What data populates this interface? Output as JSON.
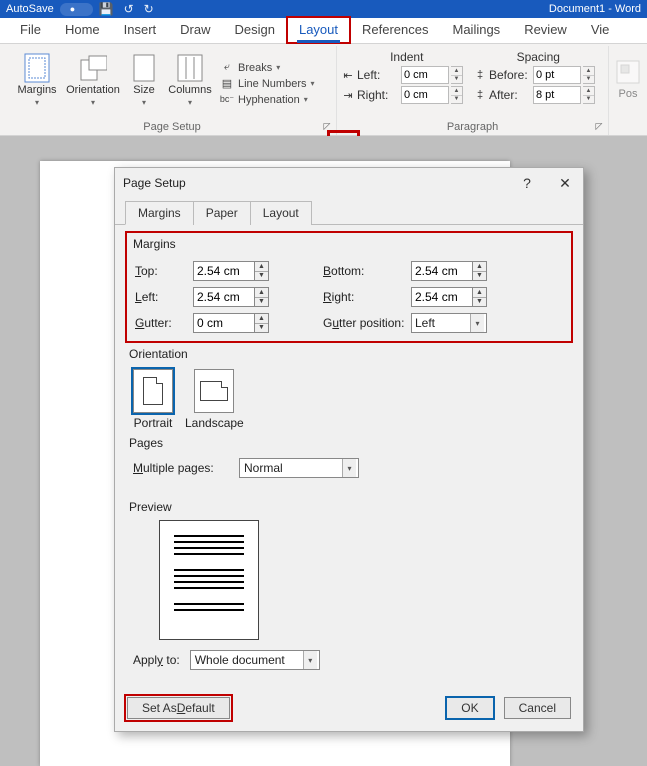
{
  "titlebar": {
    "autosave": "AutoSave",
    "doc": "Document1 - Word"
  },
  "tabs": {
    "file": "File",
    "home": "Home",
    "insert": "Insert",
    "draw": "Draw",
    "design": "Design",
    "layout": "Layout",
    "references": "References",
    "mailings": "Mailings",
    "review": "Review",
    "view": "Vie"
  },
  "ribbon": {
    "margins": "Margins",
    "orientation": "Orientation",
    "size": "Size",
    "columns": "Columns",
    "breaks": "Breaks",
    "line_numbers": "Line Numbers",
    "hyphenation": "Hyphenation",
    "page_setup_group": "Page Setup",
    "indent_header": "Indent",
    "spacing_header": "Spacing",
    "left_label": "Left:",
    "right_label": "Right:",
    "before_label": "Before:",
    "after_label": "After:",
    "left_val": "0 cm",
    "right_val": "0 cm",
    "before_val": "0 pt",
    "after_val": "8 pt",
    "paragraph_group": "Paragraph",
    "position": "Pos"
  },
  "dialog": {
    "title": "Page Setup",
    "tabs": {
      "margins": "Margins",
      "paper": "Paper",
      "layout": "Layout"
    },
    "margins_section": "Margins",
    "top": "Top:",
    "bottom": "Bottom:",
    "left": "Left:",
    "right": "Right:",
    "gutter": "Gutter:",
    "gutter_pos": "Gutter position:",
    "top_val": "2.54 cm",
    "bottom_val": "2.54 cm",
    "left_val": "2.54 cm",
    "right_val": "2.54 cm",
    "gutter_val": "0 cm",
    "gutter_pos_val": "Left",
    "orientation_section": "Orientation",
    "portrait": "Portrait",
    "landscape": "Landscape",
    "pages_section": "Pages",
    "multiple_pages": "Multiple pages:",
    "multiple_pages_val": "Normal",
    "preview_section": "Preview",
    "apply_to": "Apply to:",
    "apply_to_val": "Whole document",
    "set_default": "Set As Default",
    "ok": "OK",
    "cancel": "Cancel"
  }
}
